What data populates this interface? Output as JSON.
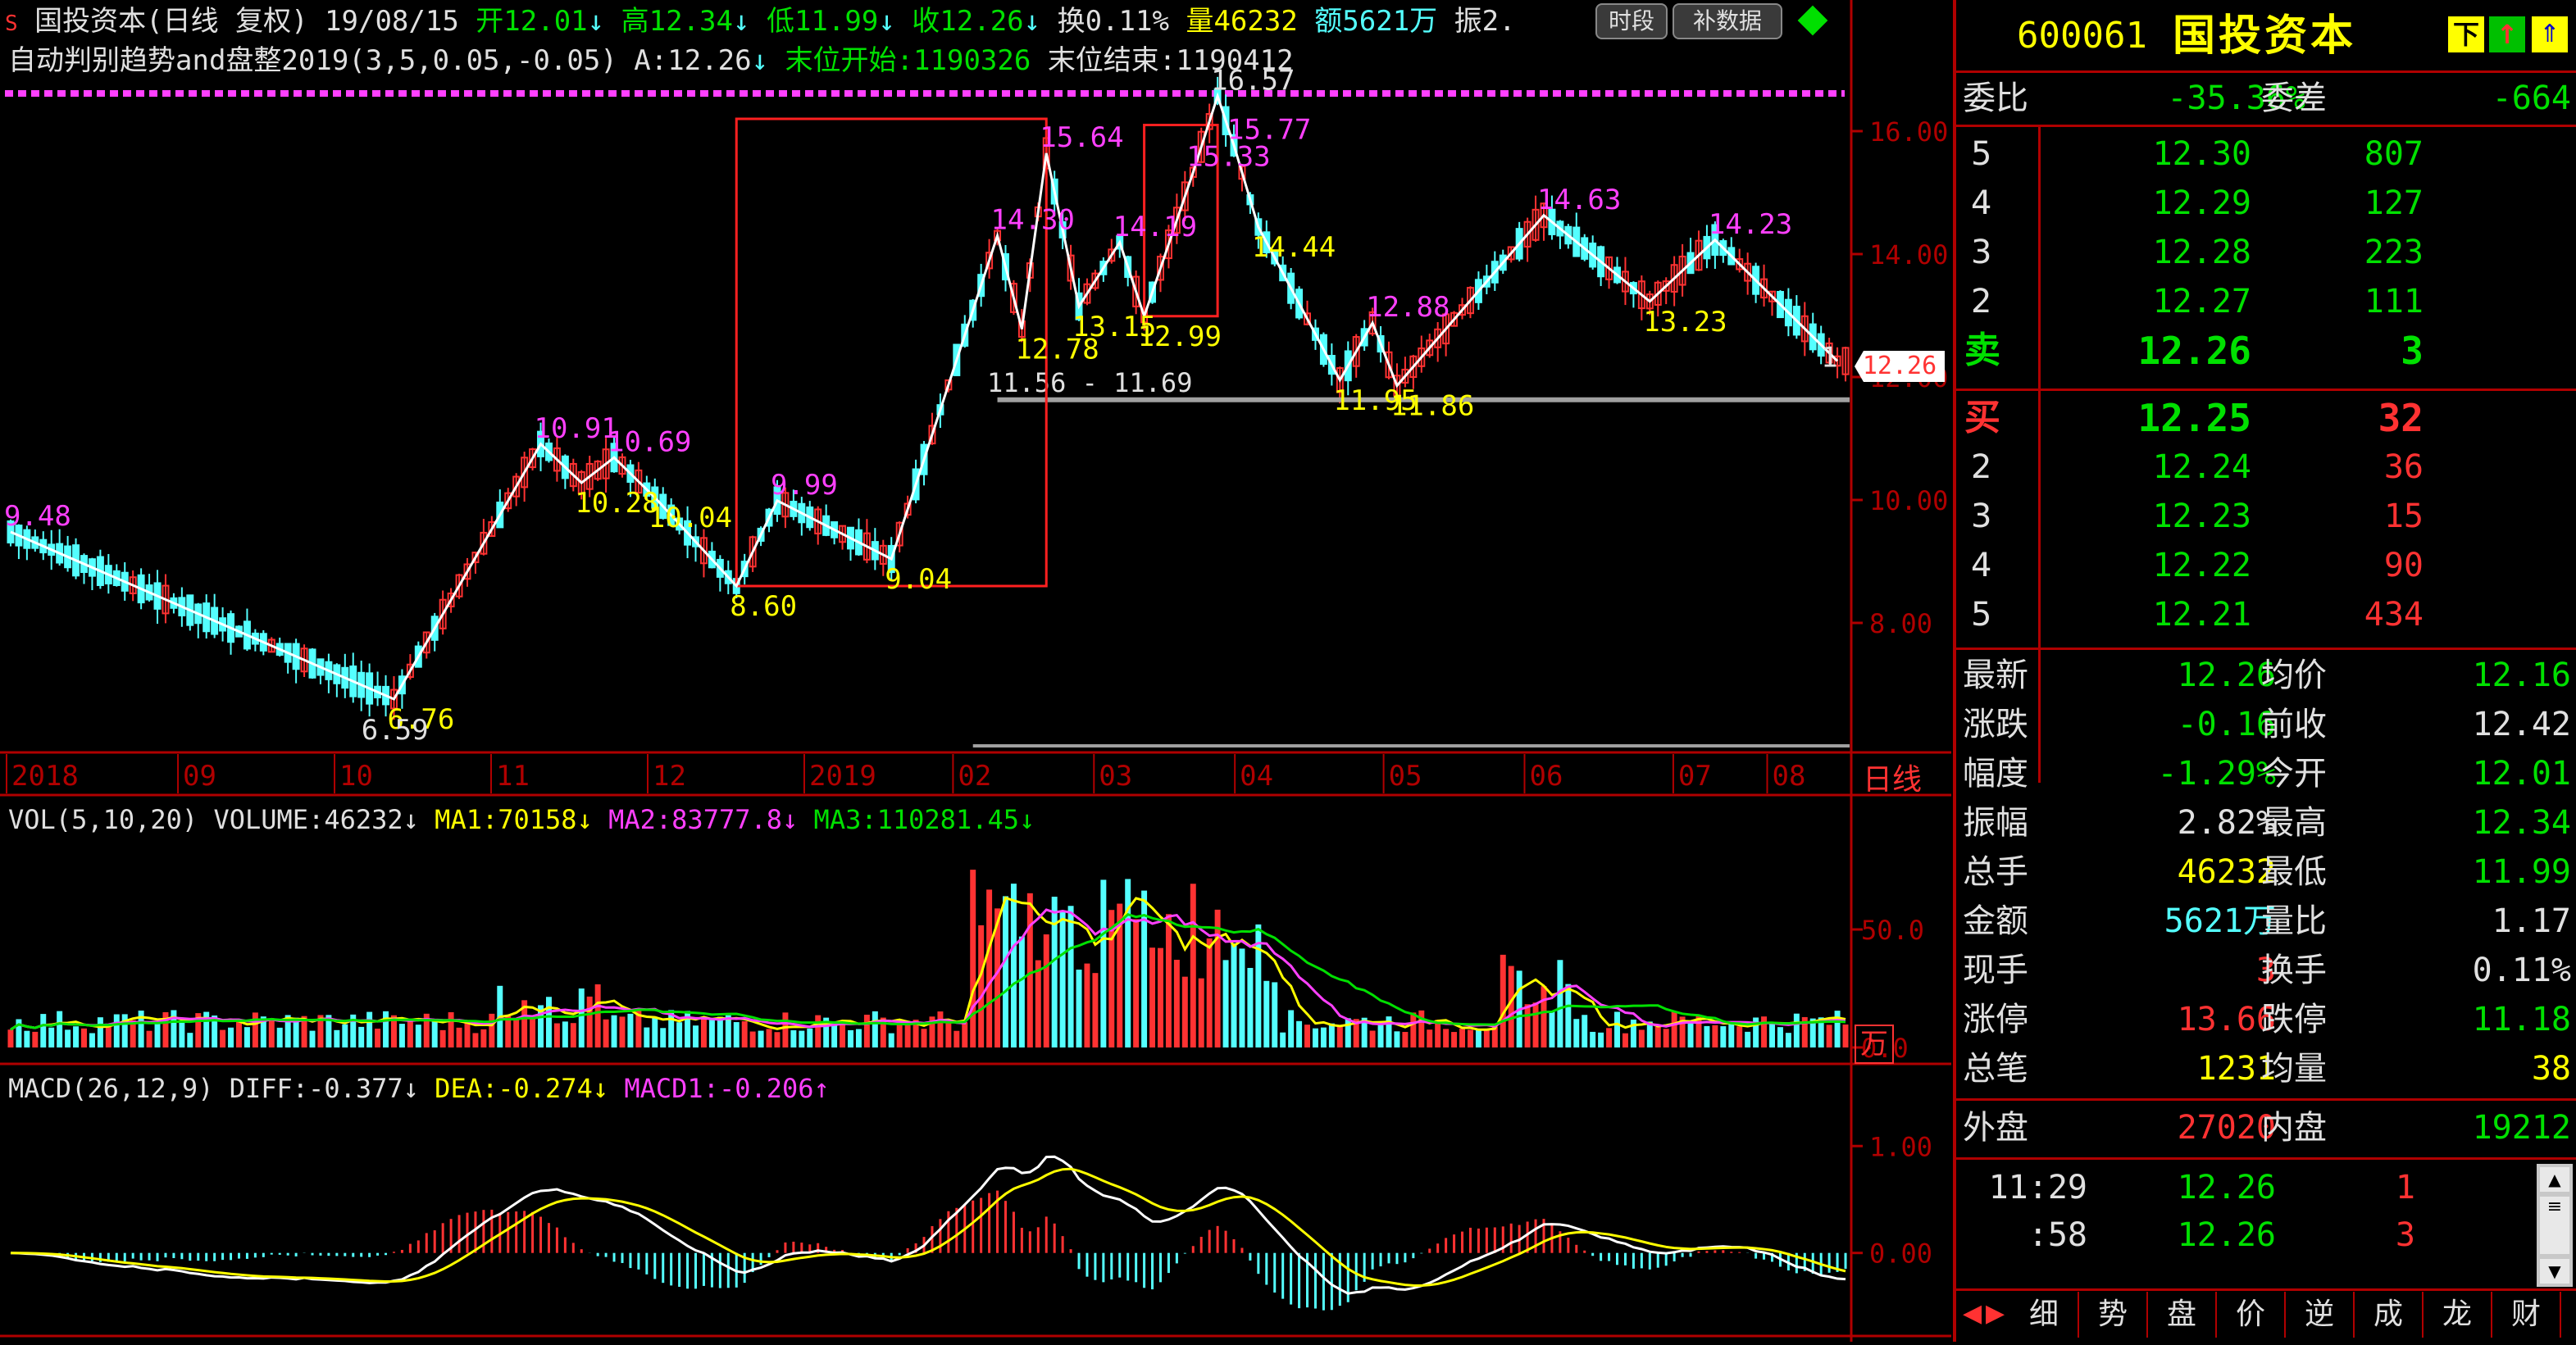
{
  "header": {
    "marker": "S",
    "title": "国投资本(日线 复权)",
    "date": "19/08/15",
    "open": "开12.01",
    "high": "高12.34",
    "low": "低11.99",
    "close": "收12.26",
    "turnover": "换0.11%",
    "volume": "量46232",
    "amount": "额5621万",
    "amplitude": "振2.",
    "btn_timeseg": "时段",
    "btn_fill": "补数据",
    "indicator_line": "自动判别趋势and盘整2019(3,5,0.05,-0.05)",
    "indicator_a": "A:12.26",
    "indicator_start": "末位开始:1190326",
    "indicator_end": "末位结束:1190412"
  },
  "colors": {
    "up": "#ff3232",
    "down": "#54ffff",
    "ma1": "#ffff00",
    "ma2": "#ff40ff",
    "ma3": "#00e000",
    "grid_axis": "#b00000",
    "zigzag": "#ffffff",
    "label_yellow": "#ffff00",
    "label_magenta": "#ff40ff"
  },
  "chart_data": [
    {
      "type": "candlestick",
      "title": "国投资本(日线 复权)",
      "ylim": [
        6.0,
        16.8
      ],
      "y_ticks": [
        "16.00",
        "14.00",
        "12.00",
        "10.00",
        "8.00"
      ],
      "x_ticks": [
        "2018",
        "09",
        "10",
        "11",
        "12",
        "2019",
        "02",
        "03",
        "04",
        "05",
        "06",
        "07",
        "08"
      ],
      "period_label": "日线",
      "last_price_tag": "12.26",
      "support_level": 11.63,
      "range_label": "11.56 - 11.69",
      "zigzag_points": [
        {
          "x": 0,
          "y": 9.48,
          "label": "9.48",
          "color": "magenta"
        },
        {
          "x": 47,
          "y": 6.76,
          "label": "6.76",
          "color": "yellow"
        },
        {
          "x": 65,
          "y": 10.91,
          "label": "10.91",
          "color": "magenta"
        },
        {
          "x": 70,
          "y": 10.28,
          "label": "10.28",
          "color": "yellow"
        },
        {
          "x": 74,
          "y": 10.69,
          "label": "10.69",
          "color": "magenta"
        },
        {
          "x": 79,
          "y": 10.04,
          "label": "10.04",
          "color": "yellow"
        },
        {
          "x": 89,
          "y": 8.6,
          "label": "8.60",
          "color": "yellow"
        },
        {
          "x": 94,
          "y": 9.99,
          "label": "9.99",
          "color": "magenta"
        },
        {
          "x": 108,
          "y": 9.04,
          "label": "9.04",
          "color": "yellow"
        },
        {
          "x": 121,
          "y": 14.3,
          "label": "14.30",
          "color": "magenta"
        },
        {
          "x": 124,
          "y": 12.78,
          "label": "12.78",
          "color": "yellow"
        },
        {
          "x": 127,
          "y": 15.64,
          "label": "15.64",
          "color": "magenta"
        },
        {
          "x": 131,
          "y": 13.15,
          "label": "13.15",
          "color": "yellow"
        },
        {
          "x": 136,
          "y": 14.19,
          "label": "14.19",
          "color": "magenta"
        },
        {
          "x": 139,
          "y": 12.99,
          "label": "12.99",
          "color": "yellow"
        },
        {
          "x": 145,
          "y": 15.33,
          "label": "15.33",
          "color": "magenta"
        },
        {
          "x": 148,
          "y": 16.57,
          "label": "16.57",
          "color": "white"
        },
        {
          "x": 150,
          "y": 15.77,
          "label": "15.77",
          "color": "magenta"
        },
        {
          "x": 153,
          "y": 14.44,
          "label": "14.44",
          "color": "yellow"
        },
        {
          "x": 163,
          "y": 11.95,
          "label": "11.95",
          "color": "yellow"
        },
        {
          "x": 167,
          "y": 12.88,
          "label": "12.88",
          "color": "magenta"
        },
        {
          "x": 170,
          "y": 11.86,
          "label": "11.86",
          "color": "yellow"
        },
        {
          "x": 188,
          "y": 14.63,
          "label": "14.63",
          "color": "magenta"
        },
        {
          "x": 201,
          "y": 13.23,
          "label": "13.23",
          "color": "yellow"
        },
        {
          "x": 209,
          "y": 14.23,
          "label": "14.23",
          "color": "magenta"
        },
        {
          "x": 224,
          "y": 12.26,
          "label": "",
          "color": "white"
        }
      ],
      "extra_labels": [
        {
          "x": 43,
          "y": 6.59,
          "label": "6.59",
          "color": "white"
        },
        {
          "x": 222,
          "y": 12.65,
          "label": "1",
          "color": "white"
        }
      ],
      "boxes": [
        {
          "x0": 89,
          "x1": 127,
          "y0": 8.6,
          "y1": 16.2
        },
        {
          "x0": 139,
          "x1": 148,
          "y0": 12.99,
          "y1": 16.1
        }
      ]
    },
    {
      "type": "bar",
      "title": "VOL(5,10,20)",
      "series": [
        {
          "name": "VOLUME",
          "value": "46232"
        },
        {
          "name": "MA1",
          "value": "70158"
        },
        {
          "name": "MA2",
          "value": "83777.8"
        },
        {
          "name": "MA3",
          "value": "110281.45"
        }
      ],
      "ylim": [
        0,
        100
      ],
      "y_ticks": [
        "50.0",
        "0.0"
      ],
      "unit": "万"
    },
    {
      "type": "line",
      "title": "MACD(26,12,9)",
      "series": [
        {
          "name": "DIFF",
          "value": "-0.377"
        },
        {
          "name": "DEA",
          "value": "-0.274"
        },
        {
          "name": "MACD1",
          "value": "-0.206"
        }
      ],
      "ylim": [
        -0.7,
        1.6
      ],
      "y_ticks": [
        "1.00",
        "0.00"
      ]
    }
  ],
  "quote": {
    "code": "600061",
    "name": "国投资本",
    "icon_labels": [
      "下",
      "↑"
    ],
    "wei_bi_label": "委比",
    "wei_bi": "-35.36%",
    "wei_cha_label": "委差",
    "wei_cha": "-664",
    "sell_levels": [
      {
        "level": "5",
        "price": "12.30",
        "vol": "807"
      },
      {
        "level": "4",
        "price": "12.29",
        "vol": "127"
      },
      {
        "level": "3",
        "price": "12.28",
        "vol": "223"
      },
      {
        "level": "2",
        "price": "12.27",
        "vol": "111"
      },
      {
        "level": "卖",
        "price": "12.26",
        "vol": "3"
      }
    ],
    "buy_levels": [
      {
        "level": "买",
        "price": "12.25",
        "vol": "32"
      },
      {
        "level": "2",
        "price": "12.24",
        "vol": "36"
      },
      {
        "level": "3",
        "price": "12.23",
        "vol": "15"
      },
      {
        "level": "4",
        "price": "12.22",
        "vol": "90"
      },
      {
        "level": "5",
        "price": "12.21",
        "vol": "434"
      }
    ],
    "stats": [
      {
        "l1": "最新",
        "v1": "12.26",
        "c1": "#00e000",
        "l2": "均价",
        "v2": "12.16",
        "c2": "#00e000"
      },
      {
        "l1": "涨跌",
        "v1": "-0.16",
        "c1": "#00e000",
        "l2": "前收",
        "v2": "12.42",
        "c2": "#e0e0e0"
      },
      {
        "l1": "幅度",
        "v1": "-1.29%",
        "c1": "#00e000",
        "l2": "今开",
        "v2": "12.01",
        "c2": "#00e000"
      },
      {
        "l1": "振幅",
        "v1": "2.82%",
        "c1": "#e0e0e0",
        "l2": "最高",
        "v2": "12.34",
        "c2": "#00e000"
      },
      {
        "l1": "总手",
        "v1": "46232",
        "c1": "#ffff00",
        "l2": "最低",
        "v2": "11.99",
        "c2": "#00e000"
      },
      {
        "l1": "金额",
        "v1": "5621万",
        "c1": "#54ffff",
        "l2": "量比",
        "v2": "1.17",
        "c2": "#e0e0e0"
      },
      {
        "l1": "现手",
        "v1": "3",
        "c1": "#ff3232",
        "l2": "换手",
        "v2": "0.11%",
        "c2": "#e0e0e0"
      },
      {
        "l1": "涨停",
        "v1": "13.66",
        "c1": "#ff3232",
        "l2": "跌停",
        "v2": "11.18",
        "c2": "#00e000"
      },
      {
        "l1": "总笔",
        "v1": "1231",
        "c1": "#ffff00",
        "l2": "均量",
        "v2": "38",
        "c2": "#ffff00"
      }
    ],
    "outer_label": "外盘",
    "outer": "27020",
    "inner_label": "内盘",
    "inner": "19212",
    "ticks": [
      {
        "time": "11:29",
        "price": "12.26",
        "vol": "1"
      },
      {
        "time": ":58",
        "price": "12.26",
        "vol": "3"
      }
    ],
    "tabs": [
      "细",
      "势",
      "盘",
      "价",
      "逆",
      "成",
      "龙",
      "财"
    ]
  }
}
